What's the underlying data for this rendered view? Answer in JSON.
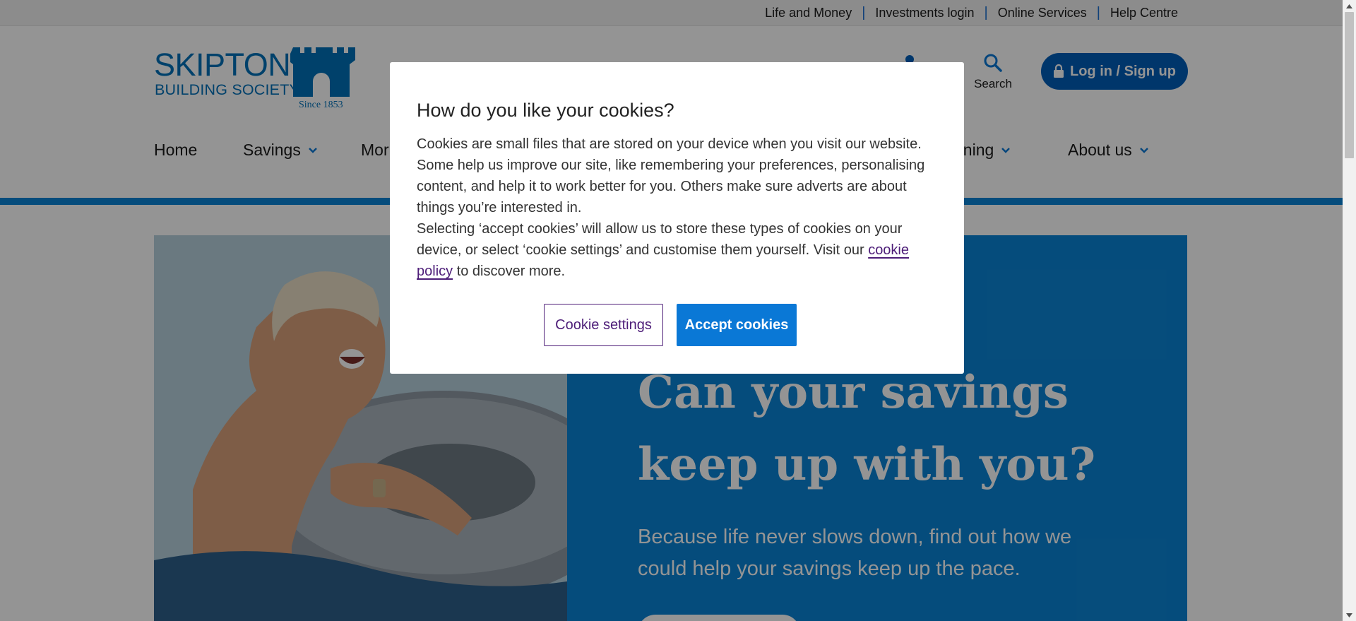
{
  "utility_nav": {
    "links": [
      "Life and Money",
      "Investments login",
      "Online Services",
      "Help Centre"
    ]
  },
  "logo": {
    "line1": "SKIPTON",
    "line2": "BUILDING SOCIETY",
    "since": "Since 1853"
  },
  "header": {
    "search_label": "Search",
    "login_label": "Log in / Sign up"
  },
  "main_nav": {
    "items": [
      "Home",
      "Savings",
      "Mor",
      "nning",
      "About us"
    ]
  },
  "hero": {
    "title_line1": "Can your savings",
    "title_line2": "keep up with you?",
    "subtitle": "Because life never slows down, find out how we could help your savings keep up the pace."
  },
  "cookie_modal": {
    "title": "How do you like your cookies?",
    "paragraph1": "Cookies are small files that are stored on your device when you visit our website. Some help us improve our site, like remembering your preferences, personalising content, and help it to work better for you. Others make sure adverts are about things you’re interested in.",
    "paragraph2_before": "Selecting ‘accept cookies’ will allow us to store these types of cookies on your device, or select ‘cookie settings’ and customise them yourself. Visit our ",
    "link_text": "cookie policy",
    "paragraph2_after": " to discover more.",
    "settings_label": "Cookie settings",
    "accept_label": "Accept cookies"
  },
  "colors": {
    "brand_blue": "#0070b8",
    "hero_blue": "#0a84d6",
    "login_blue": "#005eb8",
    "accept_blue": "#0a78d6",
    "link_purple": "#4d1d78"
  }
}
